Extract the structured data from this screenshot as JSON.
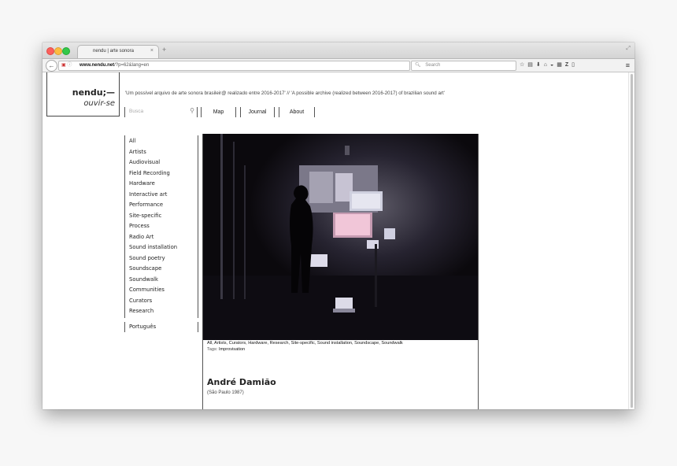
{
  "browser": {
    "tab_title": "nendu | arte sonora",
    "tab_close": "×",
    "new_tab": "+",
    "url_host": "www.nendu.net",
    "url_path": "/?p=62&lang=en",
    "search_placeholder": "Search",
    "icons": [
      "back-icon",
      "info-icon",
      "lock-icon",
      "reload-icon",
      "search-icon",
      "star-icon",
      "reading-list-icon",
      "download-icon",
      "home-icon",
      "pocket-icon",
      "extension-icon",
      "zotero-icon",
      "addon-icon",
      "hamburger-menu-icon"
    ]
  },
  "site": {
    "logo_main": "nendu;—",
    "logo_sub": "ouvir-se",
    "tagline": "'Um possível arquivo de arte sonora brasileir@ realizado entre 2016-2017' // 'A possible archive (realized between 2016-2017) of brazilian sound art'",
    "search_placeholder": "Busca",
    "nav": {
      "map": "Map",
      "journal": "Journal",
      "about": "About"
    }
  },
  "sidebar": {
    "categories": [
      "All",
      "Artists",
      "Audiovisual",
      "Field Recording",
      "Hardware",
      "Interactive art",
      "Performance",
      "Site-specific",
      "Process",
      "Radio Art",
      "Sound installation",
      "Sound poetry",
      "Soundscape",
      "Soundwalk",
      "Communities",
      "Curators",
      "Research"
    ],
    "language": "Português"
  },
  "article": {
    "categories": "All, Artists, Curators, Hardware, Research, Site-specific, Sound installation, Soundscape, Soundwalk",
    "tags_label": "Tags:",
    "tags": "Improvisation",
    "title": "André Damião",
    "subtitle": "(São Paulo 1987)"
  },
  "colors": {
    "accent": "#222222",
    "page_bg": "#f7f7f7",
    "photo_bg": "#0b090d"
  }
}
